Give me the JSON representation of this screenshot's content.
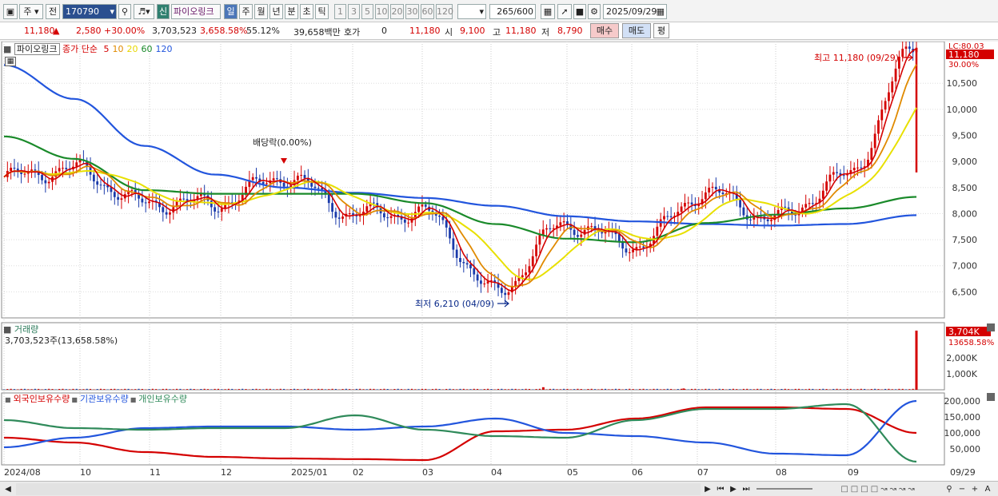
{
  "toolbar": {
    "period_main": "주",
    "prev_label": "전",
    "stock_code": "170790",
    "badge_new": "신",
    "stock_name": "파이오링크",
    "periods": [
      "일",
      "주",
      "월",
      "년",
      "분",
      "초",
      "틱"
    ],
    "intervals": [
      "1",
      "3",
      "5",
      "10",
      "20",
      "30",
      "60",
      "120"
    ],
    "count": "265",
    "count_total": "/600",
    "date": "2025/09/29"
  },
  "quote": {
    "price": "11,180",
    "change": "2,580",
    "change_pct": "+30.00%",
    "volume": "3,703,523",
    "vol_ratio": "3,658.58%",
    "turnover": "55.12%",
    "amount": "39,658백만",
    "hoga_label": "호가",
    "hoga_value": "0",
    "hoga_price": "11,180",
    "open_label": "시",
    "open": "9,100",
    "high_label": "고",
    "high": "11,180",
    "low_label": "저",
    "low": "8,790",
    "buy_label": "매수",
    "sell_label": "매도",
    "avg_label": "평"
  },
  "price_pane": {
    "name_label": "파이오링크",
    "ma_prefix": "종가 단순",
    "ma_periods": [
      {
        "label": "5",
        "color": "#d40000"
      },
      {
        "label": "10",
        "color": "#e08a00"
      },
      {
        "label": "20",
        "color": "#e8d800"
      },
      {
        "label": "60",
        "color": "#1a8a2a"
      },
      {
        "label": "120",
        "color": "#2255dd"
      }
    ],
    "corner_top": "LC:80.03",
    "last_price_tag": "11,180",
    "last_pct_tag": "30.00%",
    "high_annotation": "최고 11,180 (09/29)",
    "low_annotation": "최저 6,210 (04/09)",
    "dividend_annotation": "배당락(0.00%)",
    "y_ticks": [
      "10,500",
      "10,000",
      "9,500",
      "9,000",
      "8,500",
      "8,000",
      "7,500",
      "7,000",
      "6,500"
    ]
  },
  "volume_pane": {
    "title": "거래량",
    "subtitle": "3,703,523주(13,658.58%)",
    "last_tag": "3,704K",
    "last_pct_tag": "13658.58%",
    "y_ticks": [
      "2,000K",
      "1,000K"
    ]
  },
  "holding_pane": {
    "series": [
      {
        "name": "외국인보유수량",
        "color": "#d40000"
      },
      {
        "name": "기관보유수량",
        "color": "#2255dd"
      },
      {
        "name": "개인보유수량",
        "color": "#2f8a5a"
      }
    ],
    "y_ticks": [
      "200,000",
      "150,000",
      "100,000",
      "50,000"
    ]
  },
  "x_axis": {
    "labels": [
      "2024/08",
      "10",
      "11",
      "12",
      "2025/01",
      "02",
      "03",
      "04",
      "05",
      "06",
      "07",
      "08",
      "09",
      "09/29"
    ]
  },
  "chart_data": {
    "type": "line",
    "title": "",
    "ylim": [
      6000,
      11300
    ],
    "series": [
      {
        "name": "MA120",
        "x": [
          "2024/08",
          "10",
          "11",
          "12",
          "2025/01",
          "02",
          "03",
          "04",
          "05",
          "06",
          "07",
          "08",
          "09",
          "09/29"
        ],
        "values": [
          10850,
          10200,
          9300,
          8750,
          8500,
          8400,
          8300,
          8150,
          7950,
          7850,
          7800,
          7770,
          7800,
          7970
        ]
      },
      {
        "name": "MA60",
        "x": [
          "2024/08",
          "10",
          "11",
          "12",
          "2025/01",
          "02",
          "03",
          "04",
          "05",
          "06",
          "07",
          "08",
          "09",
          "09/29"
        ],
        "values": [
          9480,
          9050,
          8450,
          8380,
          8380,
          8380,
          8200,
          7800,
          7520,
          7450,
          7820,
          7980,
          8100,
          8320
        ]
      },
      {
        "name": "Close",
        "x": [
          "2024/08",
          "10",
          "11",
          "12",
          "2025/01",
          "02",
          "03",
          "04",
          "05",
          "06",
          "07",
          "08",
          "09",
          "09/29"
        ],
        "values": [
          8700,
          8850,
          8200,
          8200,
          8700,
          8000,
          8000,
          6500,
          7800,
          7400,
          8400,
          7900,
          8700,
          11180
        ]
      }
    ],
    "volume": {
      "last": "3,704K",
      "highlights": [
        {
          "x": "04",
          "value": 160
        },
        {
          "x": "06",
          "value": 80
        },
        {
          "x": "09/29",
          "value": 3704
        }
      ]
    },
    "holdings": {
      "x": [
        "2024/08",
        "10",
        "11",
        "12",
        "2025/01",
        "02",
        "03",
        "04",
        "05",
        "06",
        "07",
        "08",
        "09",
        "09/29"
      ],
      "외국인보유수량": [
        85000,
        70000,
        40000,
        25000,
        20000,
        18000,
        15000,
        105000,
        110000,
        145000,
        180000,
        180000,
        175000,
        100000
      ],
      "기관보유수량": [
        55000,
        85000,
        115000,
        120000,
        120000,
        110000,
        120000,
        145000,
        100000,
        90000,
        70000,
        35000,
        30000,
        200000
      ],
      "개인보유수량": [
        140000,
        115000,
        110000,
        115000,
        115000,
        155000,
        110000,
        90000,
        85000,
        140000,
        175000,
        175000,
        190000,
        10000
      ]
    }
  }
}
